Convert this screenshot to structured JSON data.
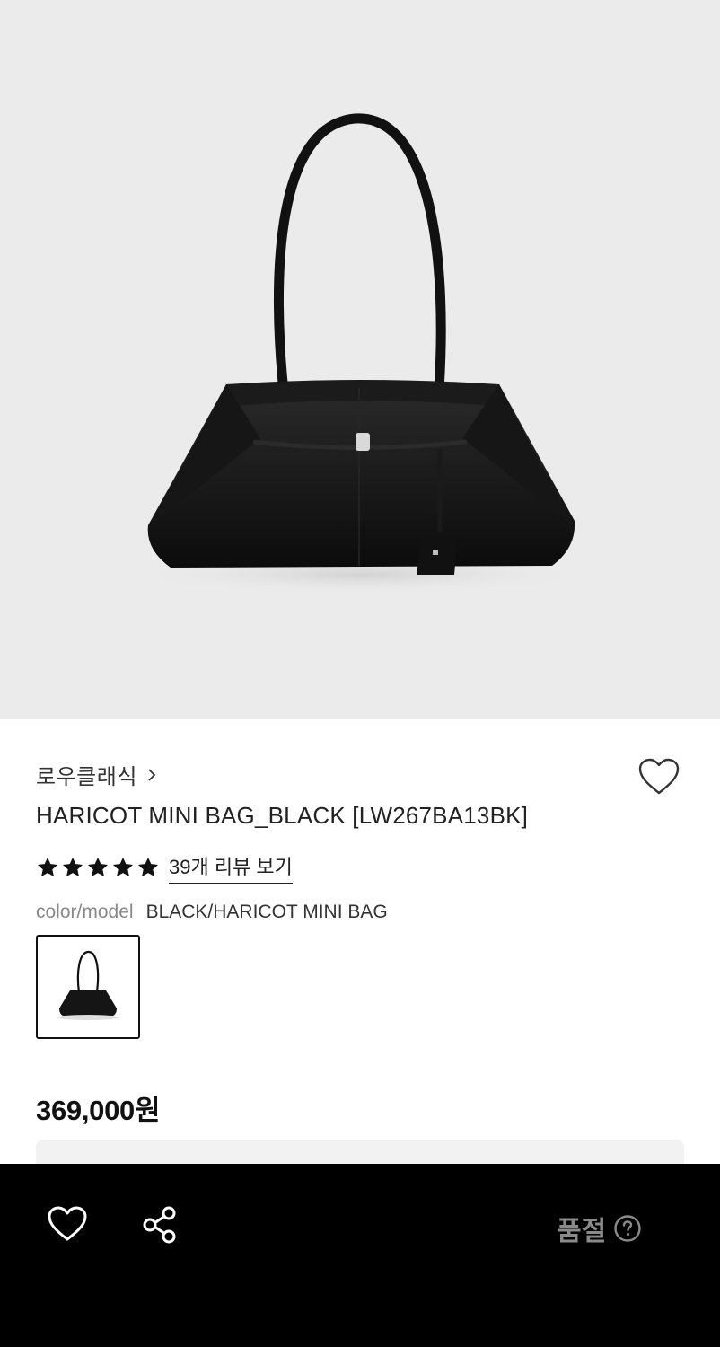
{
  "product": {
    "brand": "로우클래식",
    "name": "HARICOT MINI BAG_BLACK [LW267BA13BK]",
    "rating": 5,
    "rating_max": 5,
    "review_link": "39개 리뷰 보기",
    "option_label": "color/model",
    "option_value": "BLACK/HARICOT MINI BAG",
    "price": "369,000원"
  },
  "bottom_bar": {
    "status": "품절"
  },
  "icons": {
    "brand_chevron": "chevron-right-icon",
    "wishlist": "heart-outline-icon",
    "share": "share-icon",
    "help": "question-circle-icon",
    "star": "star-filled-icon"
  },
  "colors": {
    "hero_background": "#ebebeb",
    "bottom_bar": "#000000",
    "soldout_text": "#8a8a8a",
    "star": "#111111"
  }
}
